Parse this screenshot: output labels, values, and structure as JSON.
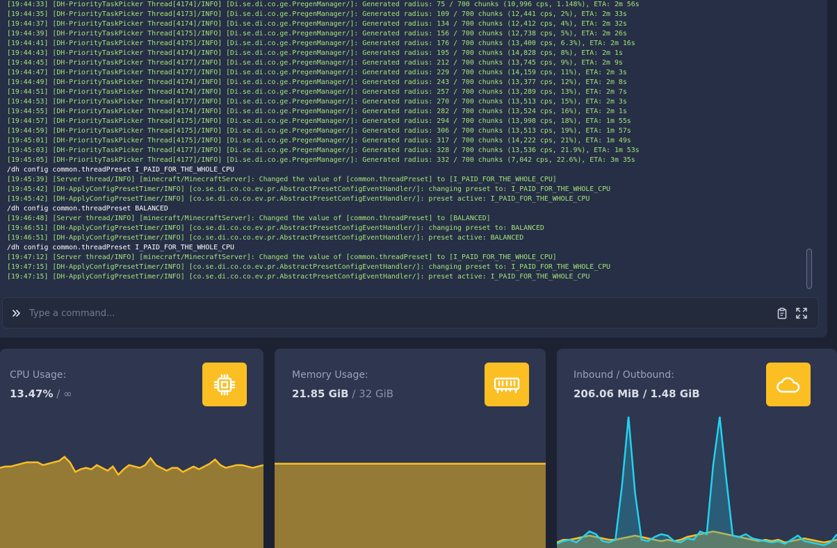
{
  "console": {
    "lines": [
      {
        "type": "log",
        "text": "[19:44:33] [DH-PriorityTaskPicker Thread[4174]/INFO] [Di.se.di.co.ge.PregenManager/]: Generated radius: 75 / 700 chunks (10,996 cps, 1.148%), ETA: 2m 56s"
      },
      {
        "type": "log",
        "text": "[19:44:35] [DH-PriorityTaskPicker Thread[4173]/INFO] [Di.se.di.co.ge.PregenManager/]: Generated radius: 109 / 700 chunks (12,441 cps, 2%), ETA: 2m 33s"
      },
      {
        "type": "log",
        "text": "[19:44:37] [DH-PriorityTaskPicker Thread[4174]/INFO] [Di.se.di.co.ge.PregenManager/]: Generated radius: 134 / 700 chunks (12,412 cps, 4%), ETA: 2m 32s"
      },
      {
        "type": "log",
        "text": "[19:44:39] [DH-PriorityTaskPicker Thread[4175]/INFO] [Di.se.di.co.ge.PregenManager/]: Generated radius: 156 / 700 chunks (12,738 cps, 5%), ETA: 2m 26s"
      },
      {
        "type": "log",
        "text": "[19:44:41] [DH-PriorityTaskPicker Thread[4175]/INFO] [Di.se.di.co.ge.PregenManager/]: Generated radius: 176 / 700 chunks (13,400 cps, 6.3%), ETA: 2m 16s"
      },
      {
        "type": "log",
        "text": "[19:44:43] [DH-PriorityTaskPicker Thread[4174]/INFO] [Di.se.di.co.ge.PregenManager/]: Generated radius: 195 / 700 chunks (14,828 cps, 8%), ETA: 2m 1s"
      },
      {
        "type": "log",
        "text": "[19:44:45] [DH-PriorityTaskPicker Thread[4177]/INFO] [Di.se.di.co.ge.PregenManager/]: Generated radius: 212 / 700 chunks (13,745 cps, 9%), ETA: 2m 9s"
      },
      {
        "type": "log",
        "text": "[19:44:47] [DH-PriorityTaskPicker Thread[4177]/INFO] [Di.se.di.co.ge.PregenManager/]: Generated radius: 229 / 700 chunks (14,159 cps, 11%), ETA: 2m 3s"
      },
      {
        "type": "log",
        "text": "[19:44:49] [DH-PriorityTaskPicker Thread[4174]/INFO] [Di.se.di.co.ge.PregenManager/]: Generated radius: 243 / 700 chunks (13,377 cps, 12%), ETA: 2m 8s"
      },
      {
        "type": "log",
        "text": "[19:44:51] [DH-PriorityTaskPicker Thread[4174]/INFO] [Di.se.di.co.ge.PregenManager/]: Generated radius: 257 / 700 chunks (13,289 cps, 13%), ETA: 2m 7s"
      },
      {
        "type": "log",
        "text": "[19:44:53] [DH-PriorityTaskPicker Thread[4177]/INFO] [Di.se.di.co.ge.PregenManager/]: Generated radius: 270 / 700 chunks (13,513 cps, 15%), ETA: 2m 3s"
      },
      {
        "type": "log",
        "text": "[19:44:55] [DH-PriorityTaskPicker Thread[4174]/INFO] [Di.se.di.co.ge.PregenManager/]: Generated radius: 282 / 700 chunks (13,524 cps, 16%), ETA: 2m 1s"
      },
      {
        "type": "log",
        "text": "[19:44:57] [DH-PriorityTaskPicker Thread[4175]/INFO] [Di.se.di.co.ge.PregenManager/]: Generated radius: 294 / 700 chunks (13,998 cps, 18%), ETA: 1m 55s"
      },
      {
        "type": "log",
        "text": "[19:44:59] [DH-PriorityTaskPicker Thread[4175]/INFO] [Di.se.di.co.ge.PregenManager/]: Generated radius: 306 / 700 chunks (13,513 cps, 19%), ETA: 1m 57s"
      },
      {
        "type": "log",
        "text": "[19:45:01] [DH-PriorityTaskPicker Thread[4175]/INFO] [Di.se.di.co.ge.PregenManager/]: Generated radius: 317 / 700 chunks (14,222 cps, 21%), ETA: 1m 49s"
      },
      {
        "type": "log",
        "text": "[19:45:03] [DH-PriorityTaskPicker Thread[4177]/INFO] [Di.se.di.co.ge.PregenManager/]: Generated radius: 328 / 700 chunks (13,536 cps, 21.9%), ETA: 1m 53s"
      },
      {
        "type": "log",
        "text": "[19:45:05] [DH-PriorityTaskPicker Thread[4177]/INFO] [Di.se.di.co.ge.PregenManager/]: Generated radius: 332 / 700 chunks (7,042 cps, 22.6%), ETA: 3m 35s"
      },
      {
        "type": "cmd",
        "text": "/dh config common.threadPreset I_PAID_FOR_THE_WHOLE_CPU"
      },
      {
        "type": "log",
        "text": "[19:45:39] [Server thread/INFO] [minecraft/MinecraftServer]: Changed the value of [common.threadPreset] to [I_PAID_FOR_THE_WHOLE_CPU]"
      },
      {
        "type": "log",
        "text": "[19:45:42] [DH-ApplyConfigPresetTimer/INFO] [co.se.di.co.co.ev.pr.AbstractPresetConfigEventHandler/]: changing preset to: I_PAID_FOR_THE_WHOLE_CPU"
      },
      {
        "type": "log",
        "text": "[19:45:42] [DH-ApplyConfigPresetTimer/INFO] [co.se.di.co.co.ev.pr.AbstractPresetConfigEventHandler/]: preset active: I_PAID_FOR_THE_WHOLE_CPU"
      },
      {
        "type": "cmd",
        "text": "/dh config common.threadPreset BALANCED"
      },
      {
        "type": "log",
        "text": "[19:46:48] [Server thread/INFO] [minecraft/MinecraftServer]: Changed the value of [common.threadPreset] to [BALANCED]"
      },
      {
        "type": "log",
        "text": "[19:46:51] [DH-ApplyConfigPresetTimer/INFO] [co.se.di.co.co.ev.pr.AbstractPresetConfigEventHandler/]: changing preset to: BALANCED"
      },
      {
        "type": "log",
        "text": "[19:46:51] [DH-ApplyConfigPresetTimer/INFO] [co.se.di.co.co.ev.pr.AbstractPresetConfigEventHandler/]: preset active: BALANCED"
      },
      {
        "type": "cmd",
        "text": "/dh config common.threadPreset I_PAID_FOR_THE_WHOLE_CPU"
      },
      {
        "type": "log",
        "text": "[19:47:12] [Server thread/INFO] [minecraft/MinecraftServer]: Changed the value of [common.threadPreset] to [I_PAID_FOR_THE_WHOLE_CPU]"
      },
      {
        "type": "log",
        "text": "[19:47:15] [DH-ApplyConfigPresetTimer/INFO] [co.se.di.co.co.ev.pr.AbstractPresetConfigEventHandler/]: changing preset to: I_PAID_FOR_THE_WHOLE_CPU"
      },
      {
        "type": "log",
        "text": "[19:47:15] [DH-ApplyConfigPresetTimer/INFO] [co.se.di.co.co.ev.pr.AbstractPresetConfigEventHandler/]: preset active: I_PAID_FOR_THE_WHOLE_CPU"
      }
    ],
    "input": {
      "placeholder": "Type a command...",
      "prompt_icon": "chevrons-right-icon",
      "actions": [
        "clipboard-icon",
        "expand-icon"
      ]
    }
  },
  "theme": {
    "accent": "#fbbf24",
    "cpu_fill": "#957a36",
    "line_yellow": "#fbbf24",
    "line_cyan": "#22d3ee",
    "log_green": "#a3e27b"
  },
  "stats": {
    "cpu": {
      "title": "CPU Usage:",
      "value": "13.47%",
      "separator": " / ",
      "limit": "∞",
      "icon": "cpu-icon"
    },
    "memory": {
      "title": "Memory Usage:",
      "value": "21.85 GiB",
      "separator": " / ",
      "limit": "32 GiB",
      "icon": "memory-icon"
    },
    "network": {
      "title": "Inbound / Outbound:",
      "value": "206.06 MiB / 1.48 GiB",
      "icon": "cloud-icon"
    }
  },
  "chart_data": [
    {
      "type": "area",
      "name": "cpu",
      "ylim": [
        0,
        100
      ],
      "series": [
        {
          "values": [
            58,
            59,
            59,
            60,
            61,
            62,
            62,
            62,
            60,
            61,
            62,
            63,
            66,
            62,
            55,
            57,
            58,
            57,
            60,
            58,
            56,
            59,
            53,
            57,
            60,
            59,
            58,
            60,
            65,
            60,
            58,
            56,
            58,
            58,
            55,
            57,
            59,
            57,
            59,
            61,
            64,
            60,
            58,
            59,
            60,
            60,
            59,
            58,
            59,
            60
          ]
        }
      ]
    },
    {
      "type": "area",
      "name": "memory",
      "ylim": [
        0,
        100
      ],
      "series": [
        {
          "values": [
            61,
            61,
            61,
            61,
            61,
            61,
            61,
            61,
            61,
            61,
            61,
            61,
            61,
            61,
            61,
            61,
            61,
            61,
            61,
            61,
            61,
            61,
            61,
            61,
            61,
            61,
            61,
            61,
            61,
            61,
            61,
            61,
            61,
            61,
            61,
            61,
            61,
            61,
            61,
            61,
            61,
            61,
            61,
            61,
            61,
            61,
            61,
            61,
            61,
            61
          ]
        }
      ]
    },
    {
      "type": "area",
      "name": "network",
      "ylim": [
        0,
        100
      ],
      "series": [
        {
          "values": [
            3,
            5,
            6,
            4,
            8,
            12,
            10,
            5,
            4,
            6,
            45,
            95,
            40,
            6,
            5,
            8,
            10,
            9,
            5,
            4,
            7,
            6,
            12,
            10,
            60,
            95,
            50,
            9,
            8,
            10,
            7,
            6,
            5,
            4,
            5,
            3,
            6,
            9,
            5,
            4,
            3,
            2,
            4,
            10
          ]
        },
        {
          "values": [
            4,
            6,
            6,
            7,
            8,
            9,
            8,
            7,
            6,
            6,
            7,
            8,
            9,
            8,
            7,
            6,
            5,
            6,
            5,
            6,
            8,
            9,
            10,
            11,
            12,
            11,
            10,
            9,
            8,
            7,
            6,
            5,
            6,
            5,
            6,
            4,
            5,
            6,
            7,
            6,
            5,
            4,
            5,
            6
          ]
        }
      ]
    }
  ]
}
